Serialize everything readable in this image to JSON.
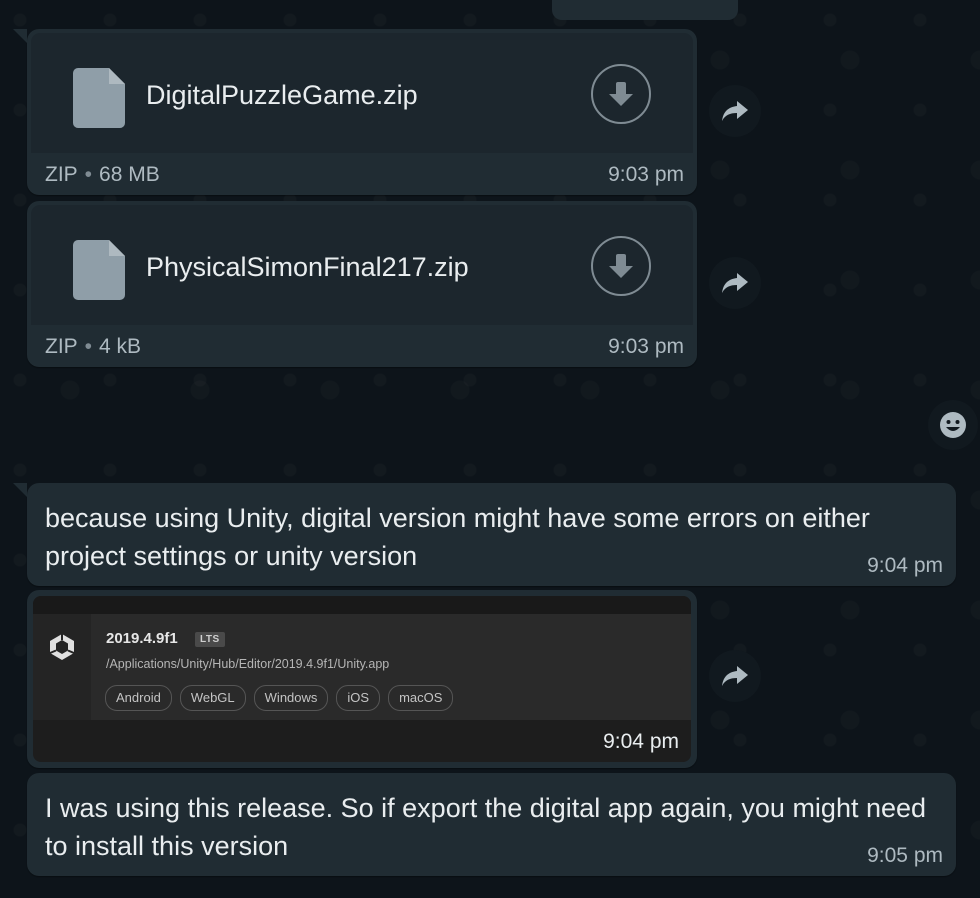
{
  "messages": {
    "file1": {
      "name": "DigitalPuzzleGame.zip",
      "type": "ZIP",
      "size": "68 MB",
      "time": "9:03 pm"
    },
    "file2": {
      "name": "PhysicalSimonFinal217.zip",
      "type": "ZIP",
      "size": "4 kB",
      "time": "9:03 pm"
    },
    "text1": {
      "text": "because using Unity, digital version might have some errors on either project settings or unity version",
      "time": "9:04 pm"
    },
    "image1": {
      "version": "2019.4.9f1",
      "badge": "LTS",
      "path": "/Applications/Unity/Hub/Editor/2019.4.9f1/Unity.app",
      "platforms": [
        "Android",
        "WebGL",
        "Windows",
        "iOS",
        "macOS"
      ],
      "time": "9:04 pm"
    },
    "text2": {
      "text": "I was using this release. So if export the digital app again, you might need to install this version",
      "time": "9:05 pm"
    }
  },
  "colors": {
    "background": "#0d141a",
    "bubble": "#202c33",
    "text": "#e9edef",
    "meta": "#aebac1"
  },
  "icons": [
    "file-icon",
    "download-icon",
    "forward-icon",
    "emoji-icon",
    "unity-logo-icon"
  ]
}
